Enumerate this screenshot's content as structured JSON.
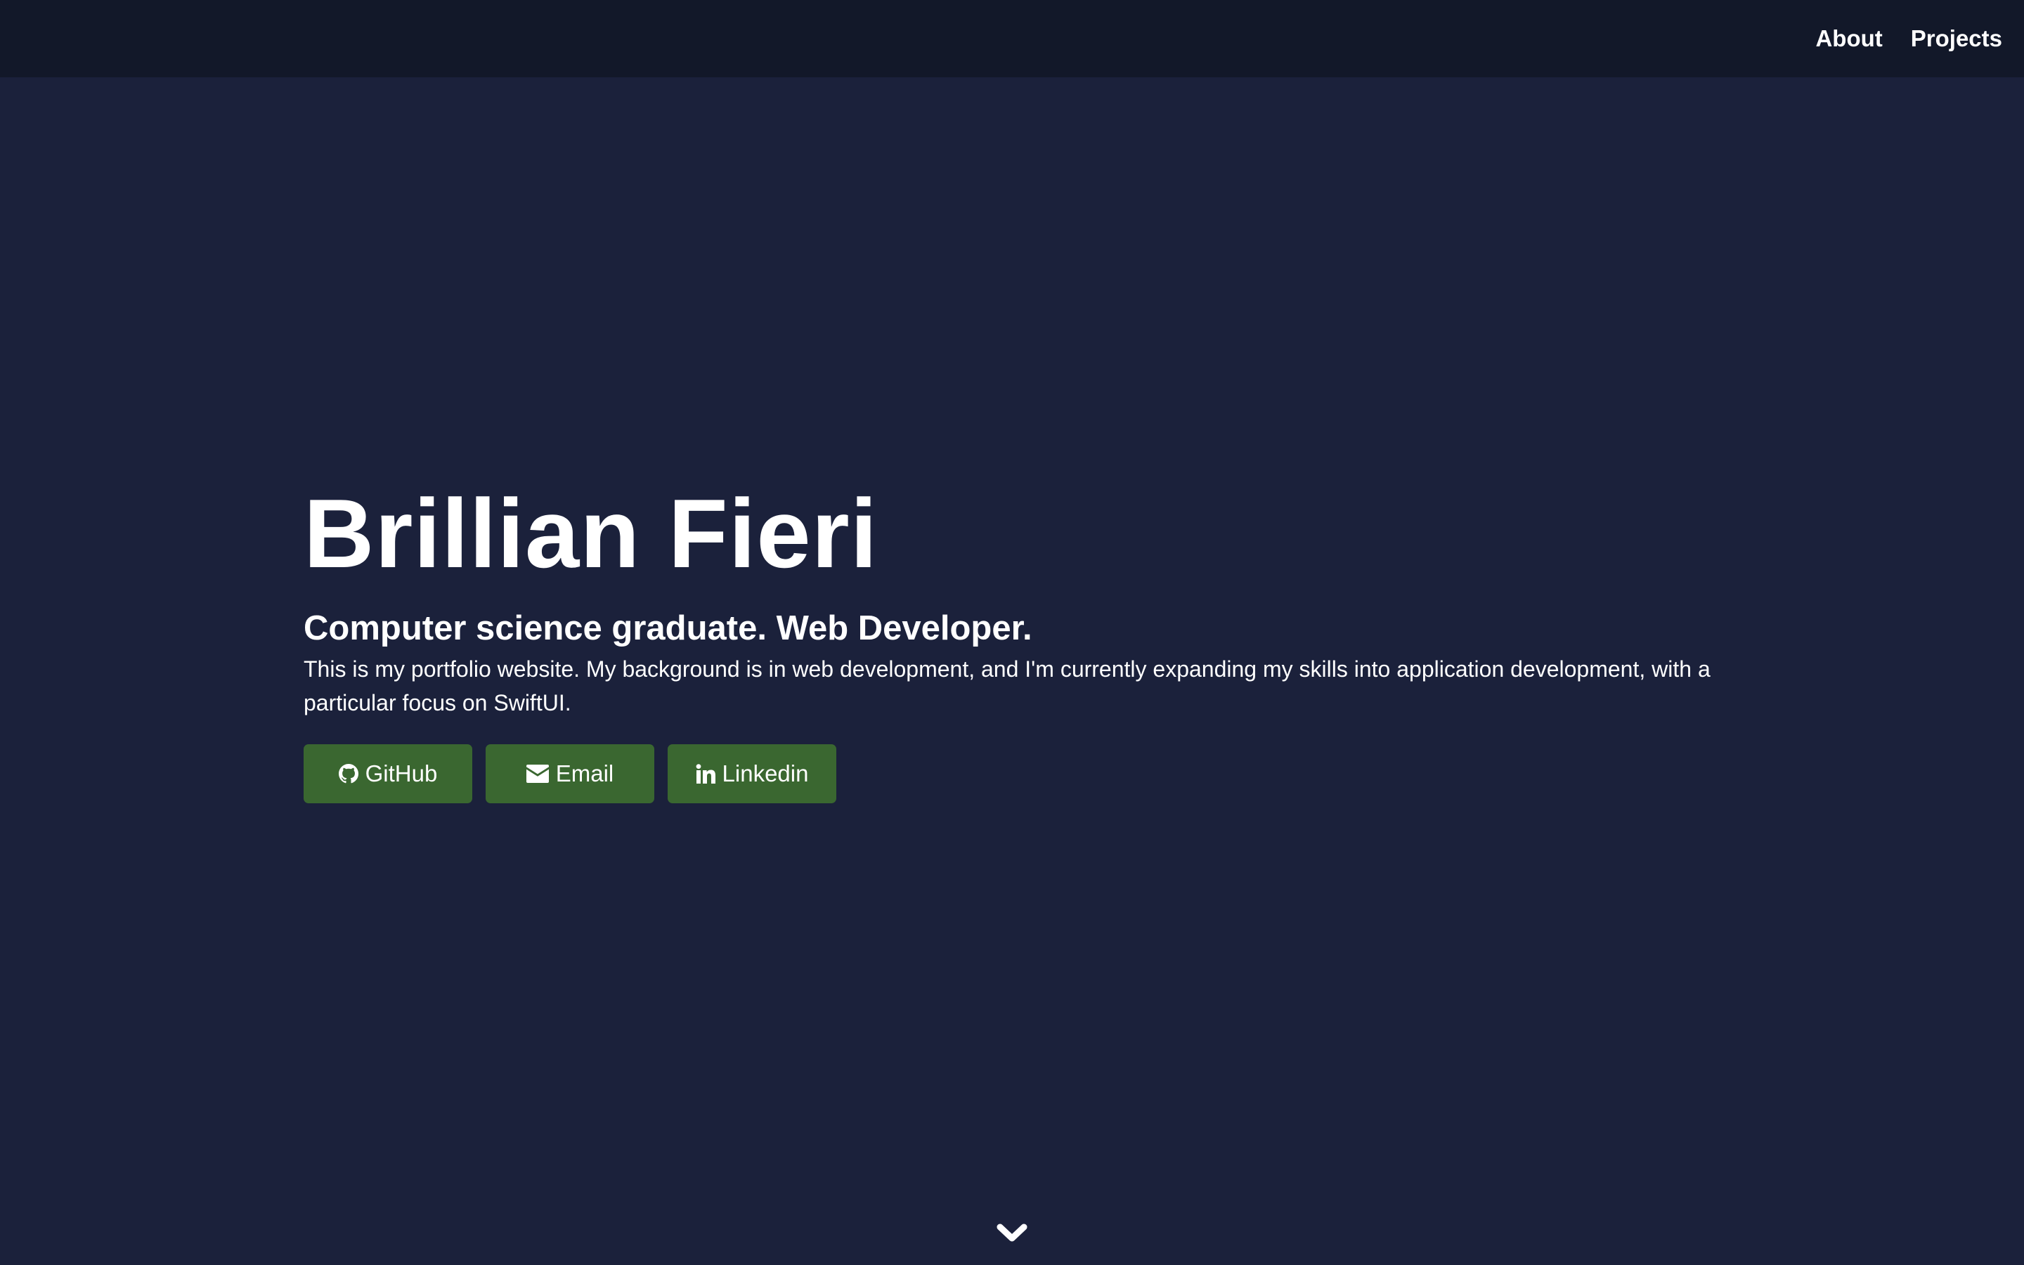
{
  "nav": {
    "items": [
      {
        "label": "About"
      },
      {
        "label": "Projects"
      }
    ]
  },
  "hero": {
    "name": "Brillian Fieri",
    "subtitle": "Computer science graduate. Web Developer.",
    "description": "This is my portfolio website. My background is in web development, and I'm currently expanding my skills into application development, with a particular focus on SwiftUI.",
    "buttons": [
      {
        "label": "GitHub",
        "icon": "github-icon"
      },
      {
        "label": "Email",
        "icon": "envelope-icon"
      },
      {
        "label": "Linkedin",
        "icon": "linkedin-icon"
      }
    ]
  },
  "scroll": {
    "icon": "chevron-down-icon"
  },
  "colors": {
    "background": "#1b213b",
    "navbar": "#121829",
    "button": "#3a6730",
    "text": "#ffffff"
  }
}
